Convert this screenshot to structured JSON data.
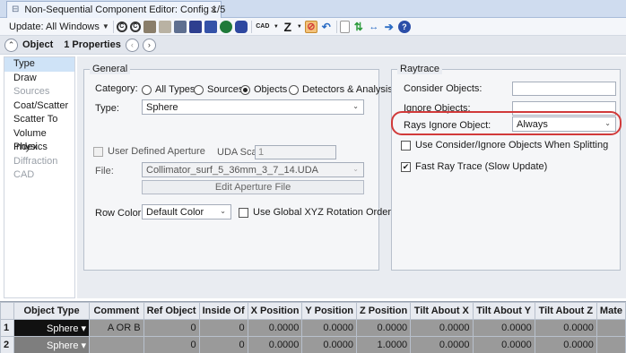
{
  "tab": {
    "title": "Non-Sequential Component Editor: Config 1/5",
    "close": "×"
  },
  "toolbar": {
    "update_label": "Update: All Windows",
    "cad_label": "CAD",
    "z_label": "Z",
    "help_label": "?"
  },
  "objbar": {
    "label": "Object",
    "properties": "1 Properties"
  },
  "nav": {
    "items": [
      {
        "label": "Type",
        "state": "selected"
      },
      {
        "label": "Draw",
        "state": "normal"
      },
      {
        "label": "Sources",
        "state": "disabled"
      },
      {
        "label": "Coat/Scatter",
        "state": "normal"
      },
      {
        "label": "Scatter To",
        "state": "normal"
      },
      {
        "label": "Volume Physics",
        "state": "normal"
      },
      {
        "label": "Index",
        "state": "normal"
      },
      {
        "label": "Diffraction",
        "state": "disabled"
      },
      {
        "label": "CAD",
        "state": "disabled"
      }
    ]
  },
  "general": {
    "title": "General",
    "category_label": "Category:",
    "category_options": [
      "All Types",
      "Sources",
      "Objects",
      "Detectors & Analysis"
    ],
    "category_selected": "Objects",
    "type_label": "Type:",
    "type_value": "Sphere",
    "user_defined_aperture": "User Defined Aperture",
    "uda_scale_label": "UDA Scale:",
    "uda_scale_value": "1",
    "file_label": "File:",
    "file_value": "Collimator_surf_5_36mm_3_7_14.UDA",
    "edit_aperture": "Edit Aperture File",
    "row_color_label": "Row Color:",
    "row_color_value": "Default Color",
    "global_xyz": "Use Global XYZ Rotation Order"
  },
  "raytrace": {
    "title": "Raytrace",
    "consider_label": "Consider Objects:",
    "consider_value": "",
    "ignore_label": "Ignore Objects:",
    "ignore_value": "",
    "rays_ignore_label": "Rays Ignore Object:",
    "rays_ignore_value": "Always",
    "splitting_label": "Use Consider/Ignore Objects When Splitting",
    "splitting_checked": false,
    "fast_trace_label": "Fast Ray Trace (Slow Update)",
    "fast_trace_checked": true
  },
  "grid": {
    "columns": [
      "",
      "Object Type",
      "Comment",
      "Ref Object",
      "Inside Of",
      "X Position",
      "Y Position",
      "Z Position",
      "Tilt About X",
      "Tilt About Y",
      "Tilt About Z",
      "Mate"
    ],
    "rows": [
      [
        "1",
        "Sphere",
        "A OR B",
        "0",
        "0",
        "0.0000",
        "0.0000",
        "0.0000",
        "0.0000",
        "0.0000",
        "0.0000",
        ""
      ],
      [
        "2",
        "Sphere",
        "",
        "0",
        "0",
        "0.0000",
        "0.0000",
        "1.0000",
        "0.0000",
        "0.0000",
        "0.0000",
        ""
      ]
    ]
  },
  "colors": {
    "highlight": "#d13a3a",
    "selection": "#cfe3f7"
  }
}
